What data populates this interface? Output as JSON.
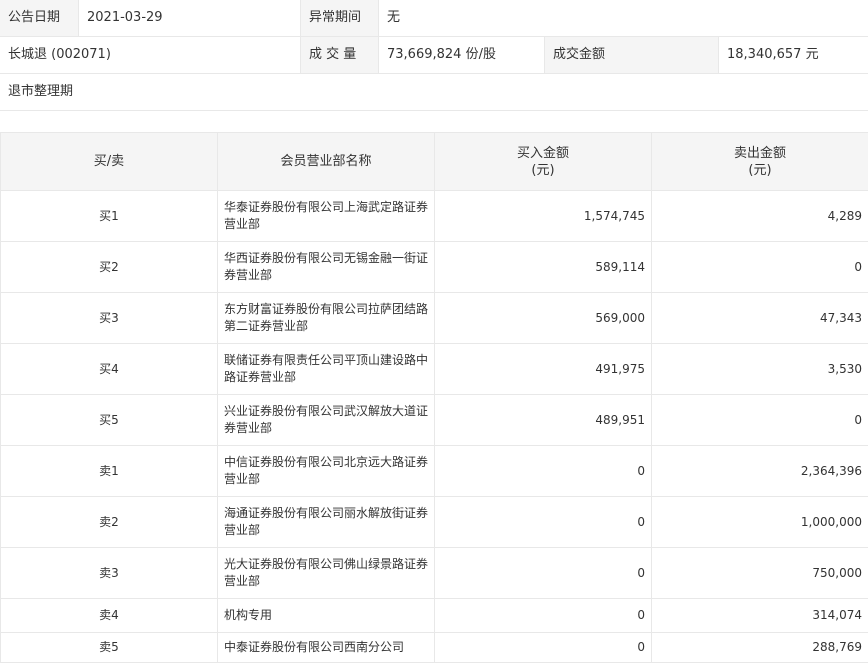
{
  "info": {
    "announce_date_label": "公告日期",
    "announce_date": "2021-03-29",
    "abnormal_period_label": "异常期间",
    "abnormal_period": "无",
    "stock_name": "长城退 (002071)",
    "volume_label": "成 交 量",
    "volume": "73,669,824 份/股",
    "turnover_label": "成交金额",
    "turnover": "18,340,657 元",
    "reason": "退市整理期"
  },
  "table": {
    "headers": {
      "side": "买/卖",
      "broker": "会员营业部名称",
      "buy_amount": "买入金额",
      "buy_unit": "(元)",
      "sell_amount": "卖出金额",
      "sell_unit": "(元)"
    },
    "rows": [
      {
        "side": "买1",
        "broker": "华泰证券股份有限公司上海武定路证券营业部",
        "buy": "1,574,745",
        "sell": "4,289"
      },
      {
        "side": "买2",
        "broker": "华西证券股份有限公司无锡金融一街证券营业部",
        "buy": "589,114",
        "sell": "0"
      },
      {
        "side": "买3",
        "broker": "东方财富证券股份有限公司拉萨团结路第二证券营业部",
        "buy": "569,000",
        "sell": "47,343"
      },
      {
        "side": "买4",
        "broker": "联储证券有限责任公司平顶山建设路中路证券营业部",
        "buy": "491,975",
        "sell": "3,530"
      },
      {
        "side": "买5",
        "broker": "兴业证券股份有限公司武汉解放大道证券营业部",
        "buy": "489,951",
        "sell": "0"
      },
      {
        "side": "卖1",
        "broker": "中信证券股份有限公司北京远大路证券营业部",
        "buy": "0",
        "sell": "2,364,396"
      },
      {
        "side": "卖2",
        "broker": "海通证券股份有限公司丽水解放街证券营业部",
        "buy": "0",
        "sell": "1,000,000"
      },
      {
        "side": "卖3",
        "broker": "光大证券股份有限公司佛山绿景路证券营业部",
        "buy": "0",
        "sell": "750,000"
      },
      {
        "side": "卖4",
        "broker": "机构专用",
        "buy": "0",
        "sell": "314,074"
      },
      {
        "side": "卖5",
        "broker": "中泰证券股份有限公司西南分公司",
        "buy": "0",
        "sell": "288,769"
      }
    ]
  }
}
